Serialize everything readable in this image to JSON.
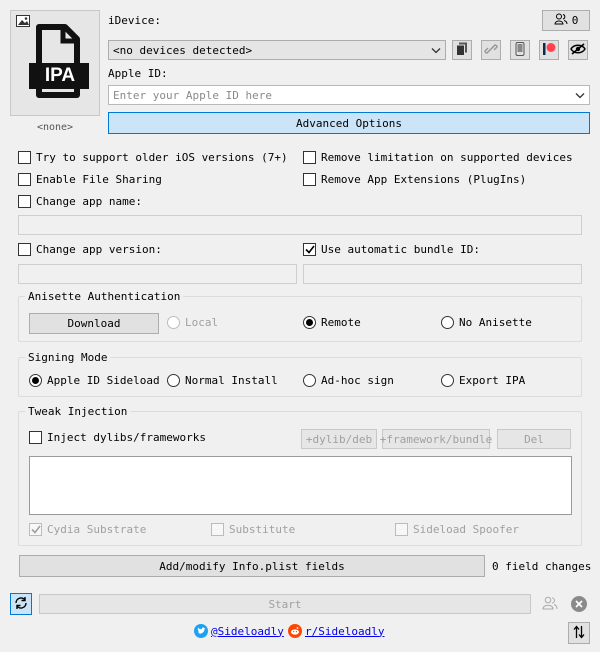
{
  "ipa": {
    "image_label": "IPA",
    "status": "<none>"
  },
  "device": {
    "label": "iDevice:",
    "selected": "<no devices detected>",
    "count": "0"
  },
  "apple_id": {
    "label": "Apple ID:",
    "placeholder": "Enter your Apple ID here"
  },
  "advanced_options_label": "Advanced Options",
  "options": {
    "older_ios": "Try to support older iOS versions (7+)",
    "remove_limitation": "Remove limitation on supported devices",
    "file_sharing": "Enable File Sharing",
    "remove_extensions": "Remove App Extensions (PlugIns)",
    "change_name": "Change app name:",
    "change_version": "Change app version:",
    "auto_bundle": "Use automatic bundle ID:"
  },
  "anisette": {
    "title": "Anisette Authentication",
    "download_label": "Download",
    "local": "Local",
    "remote": "Remote",
    "none": "No Anisette"
  },
  "signing": {
    "title": "Signing Mode",
    "sideload": "Apple ID Sideload",
    "normal": "Normal Install",
    "adhoc": "Ad-hoc sign",
    "export": "Export IPA"
  },
  "tweak": {
    "title": "Tweak Injection",
    "inject_label": "Inject dylibs/frameworks",
    "add_dylib": "+dylib/deb",
    "add_framework": "+framework/bundle",
    "del": "Del",
    "cydia": "Cydia Substrate",
    "substitute": "Substitute",
    "spoofer": "Sideload Spoofer"
  },
  "plist_label": "Add/modify Info.plist fields",
  "field_changes": "0 field changes",
  "start_label": "Start",
  "footer": {
    "twitter": "@Sideloadly",
    "reddit": "r/Sideloadly"
  },
  "colors": {
    "accent_bg": "#cce4f7",
    "accent_border": "#0078d7",
    "twitter": "#1da1f2",
    "reddit": "#ff4500",
    "patreon": "#ff424d"
  }
}
